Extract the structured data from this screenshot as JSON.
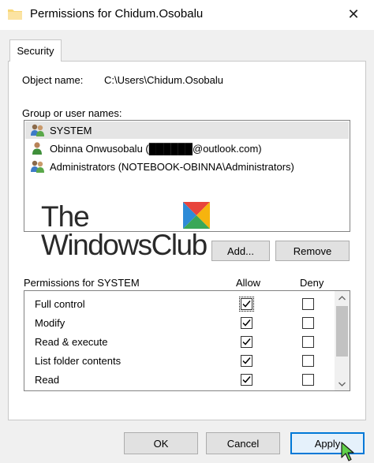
{
  "window": {
    "title": "Permissions for Chidum.Osobalu",
    "folder_icon": "folder-icon",
    "close_glyph": "✕"
  },
  "tabs": [
    {
      "label": "Security",
      "active": true
    }
  ],
  "object": {
    "label": "Object name:",
    "value": "C:\\Users\\Chidum.Osobalu"
  },
  "groups": {
    "label": "Group or user names:",
    "items": [
      {
        "name": "SYSTEM",
        "icon": "users-group-icon",
        "selected": true
      },
      {
        "name": "Obinna Onwusobalu (██████@outlook.com)",
        "icon": "user-icon",
        "selected": false
      },
      {
        "name": "Administrators (NOTEBOOK-OBINNA\\Administrators)",
        "icon": "users-group-icon",
        "selected": false
      }
    ],
    "add_label": "Add...",
    "remove_label": "Remove"
  },
  "watermark": {
    "line1": "The",
    "line2": "WindowsClub",
    "logo": "windows-club-logo"
  },
  "permissions": {
    "header": "Permissions for SYSTEM",
    "allow_header": "Allow",
    "deny_header": "Deny",
    "rows": [
      {
        "name": "Full control",
        "allow": true,
        "deny": false
      },
      {
        "name": "Modify",
        "allow": true,
        "deny": false
      },
      {
        "name": "Read & execute",
        "allow": true,
        "deny": false
      },
      {
        "name": "List folder contents",
        "allow": true,
        "deny": false
      },
      {
        "name": "Read",
        "allow": true,
        "deny": false
      }
    ]
  },
  "footer": {
    "ok_label": "OK",
    "cancel_label": "Cancel",
    "apply_label": "Apply"
  },
  "colors": {
    "dialog_bg": "#f0f0f0",
    "selection": "#e5e5e5",
    "accent": "#0078d7",
    "button_bg": "#e1e1e1"
  }
}
